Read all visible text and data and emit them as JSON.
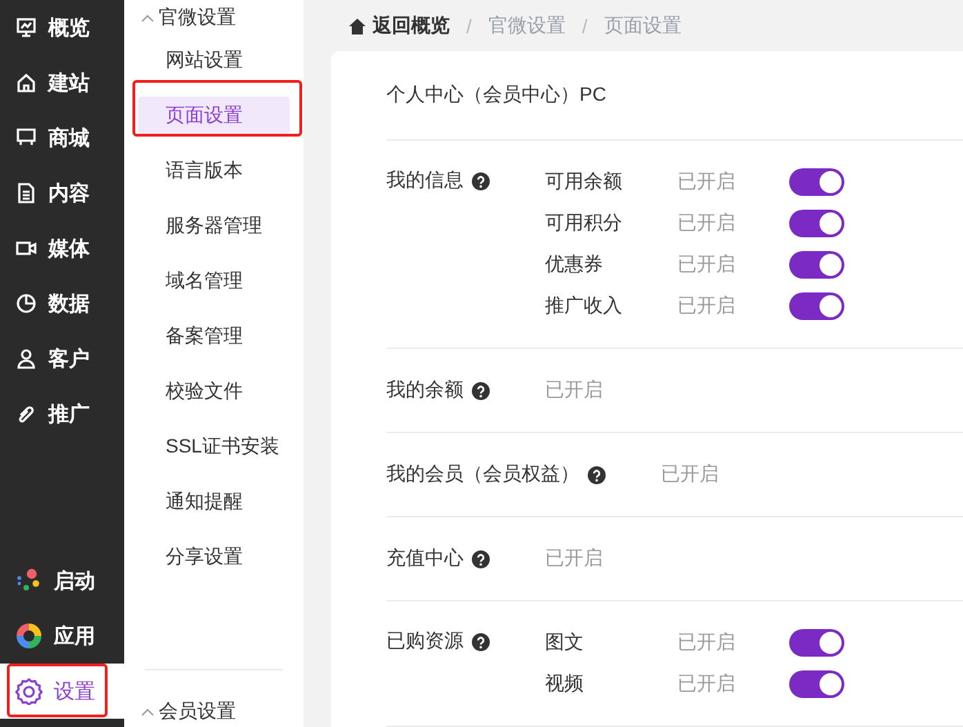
{
  "nav": {
    "items": [
      {
        "label": "概览",
        "selected": false
      },
      {
        "label": "建站",
        "selected": false
      },
      {
        "label": "商城",
        "selected": false
      },
      {
        "label": "内容",
        "selected": false
      },
      {
        "label": "媒体",
        "selected": false
      },
      {
        "label": "数据",
        "selected": false
      },
      {
        "label": "客户",
        "selected": false
      },
      {
        "label": "推广",
        "selected": false
      }
    ],
    "bottom_items": [
      {
        "label": "启动",
        "selected": false,
        "highlighted": false
      },
      {
        "label": "应用",
        "selected": false,
        "highlighted": false
      },
      {
        "label": "设置",
        "selected": true,
        "highlighted": true
      }
    ]
  },
  "submenu": {
    "groups": [
      {
        "title": "官微设置",
        "expanded": true,
        "items": [
          {
            "label": "网站设置",
            "selected": false,
            "highlighted": false
          },
          {
            "label": "页面设置",
            "selected": true,
            "highlighted": true
          },
          {
            "label": "语言版本",
            "selected": false,
            "highlighted": false
          },
          {
            "label": "服务器管理",
            "selected": false,
            "highlighted": false
          },
          {
            "label": "域名管理",
            "selected": false,
            "highlighted": false
          },
          {
            "label": "备案管理",
            "selected": false,
            "highlighted": false
          },
          {
            "label": "校验文件",
            "selected": false,
            "highlighted": false
          },
          {
            "label": "SSL证书安装",
            "selected": false,
            "highlighted": false
          },
          {
            "label": "通知提醒",
            "selected": false,
            "highlighted": false
          },
          {
            "label": "分享设置",
            "selected": false,
            "highlighted": false
          }
        ]
      },
      {
        "title": "会员设置",
        "expanded": true
      }
    ]
  },
  "breadcrumb": [
    {
      "label": "返回概览",
      "kind": "home"
    },
    {
      "label": "/",
      "kind": "separator"
    },
    {
      "label": "官微设置",
      "kind": "link"
    },
    {
      "label": "/",
      "kind": "separator"
    },
    {
      "label": "页面设置",
      "kind": "link"
    }
  ],
  "settings": {
    "title": "个人中心（会员中心）PC",
    "sections": [
      {
        "label": "我的信息",
        "help": true,
        "items": [
          {
            "label": "可用余额",
            "status": "已开启",
            "on": true
          },
          {
            "label": "可用积分",
            "status": "已开启",
            "on": true
          },
          {
            "label": "优惠券",
            "status": "已开启",
            "on": true
          },
          {
            "label": "推广收入",
            "status": "已开启",
            "on": true
          }
        ]
      },
      {
        "label": "我的余额",
        "help": true,
        "status": "已开启"
      },
      {
        "label": "我的会员（会员权益）",
        "help": true,
        "status": "已开启"
      },
      {
        "label": "充值中心",
        "help": true,
        "status": "已开启"
      },
      {
        "label": "已购资源",
        "help": true,
        "items": [
          {
            "label": "图文",
            "status": "已开启",
            "on": true
          },
          {
            "label": "视频",
            "status": "已开启",
            "on": true
          }
        ]
      }
    ]
  }
}
